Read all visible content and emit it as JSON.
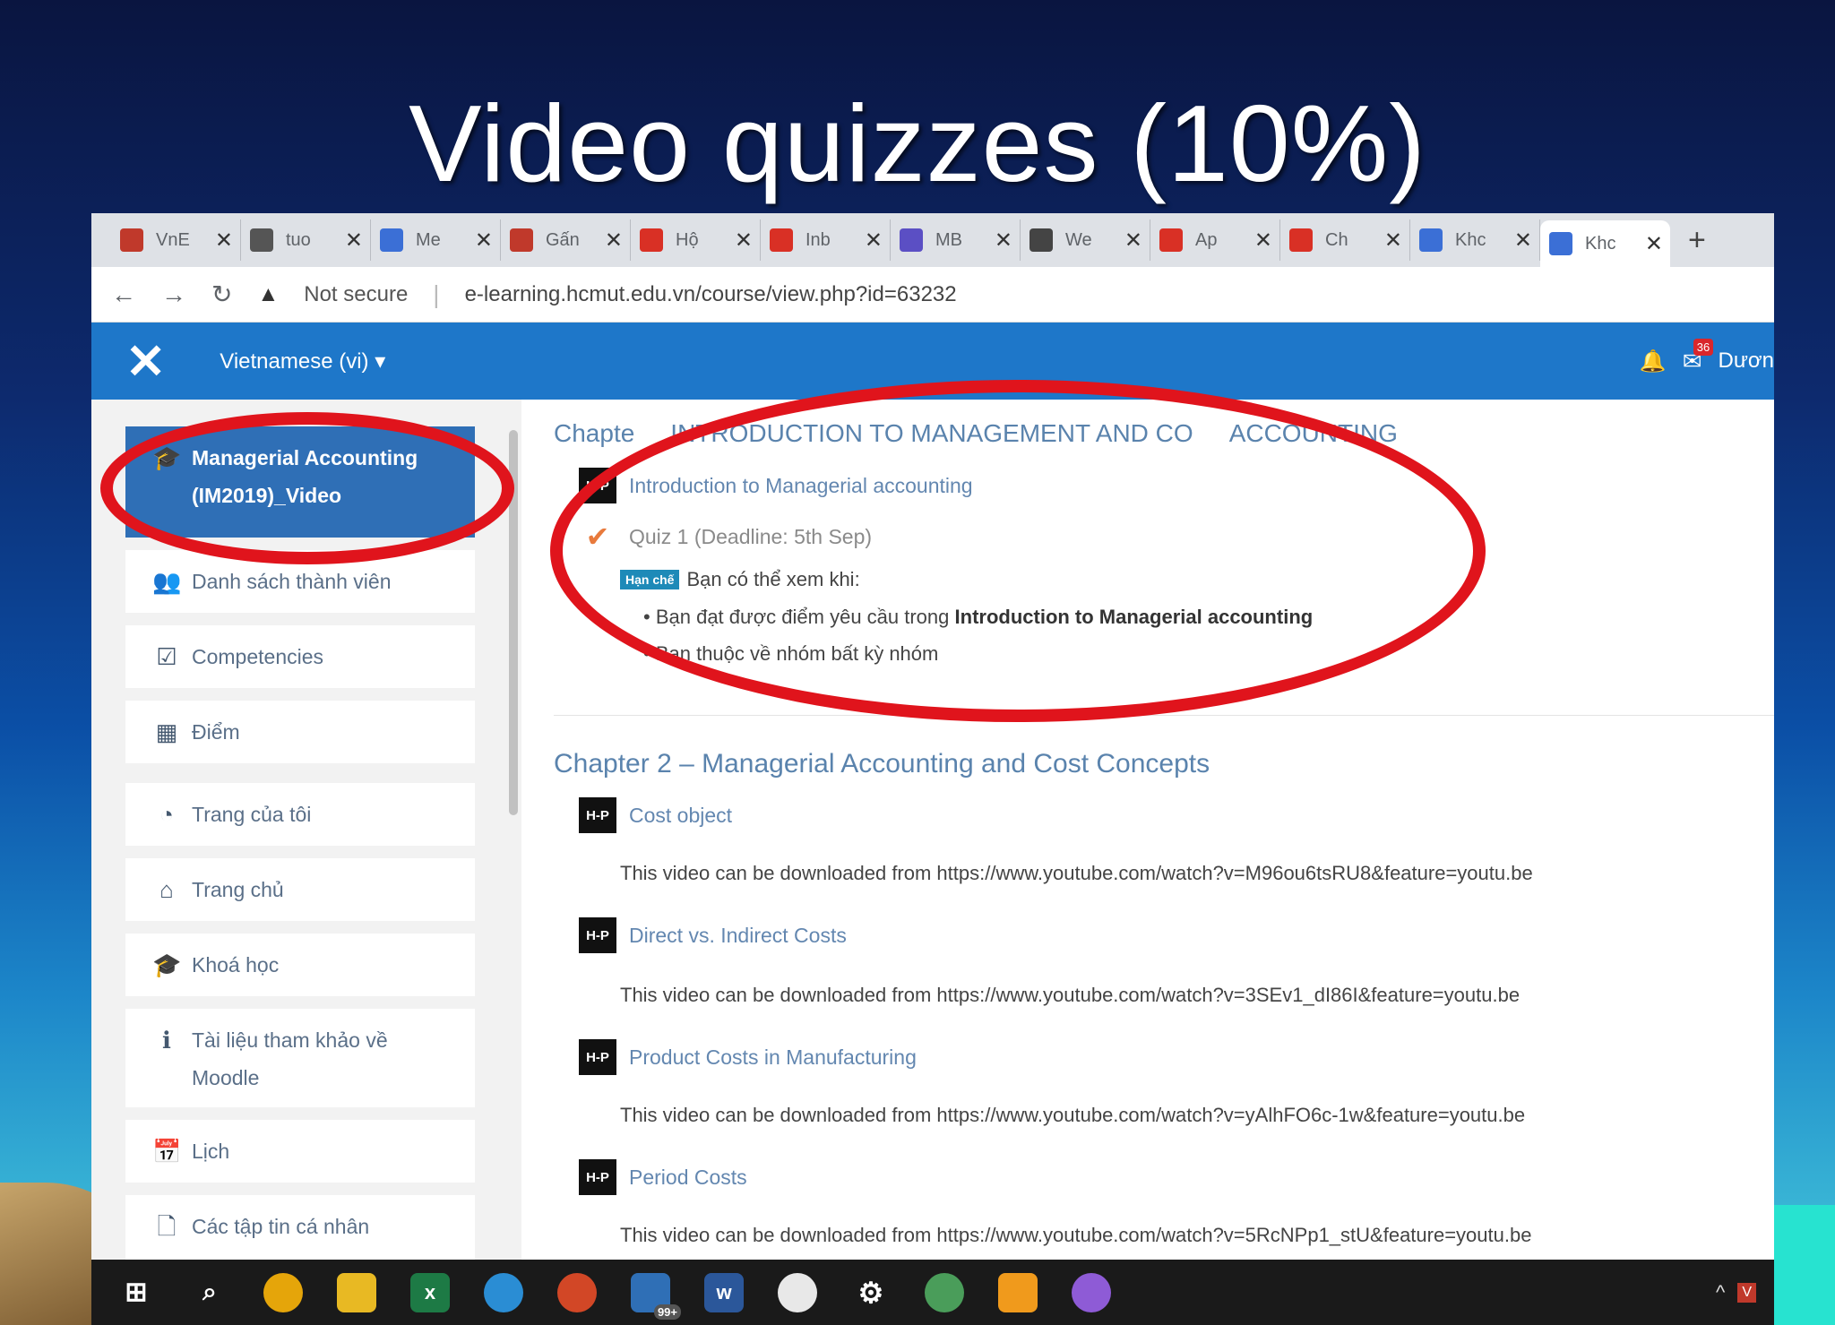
{
  "slide": {
    "title": "Video quizzes (10%)"
  },
  "browser": {
    "tabs": [
      {
        "label": "VnE",
        "favicon_color": "#c0392b"
      },
      {
        "label": "tuo",
        "favicon_color": "#555555"
      },
      {
        "label": "Me",
        "favicon_color": "#3b6fd6"
      },
      {
        "label": "Gấn",
        "favicon_color": "#c0392b"
      },
      {
        "label": "Hộ",
        "favicon_color": "#d93025"
      },
      {
        "label": "Inb",
        "favicon_color": "#d93025"
      },
      {
        "label": "MB",
        "favicon_color": "#5b4fc4"
      },
      {
        "label": "We",
        "favicon_color": "#444444"
      },
      {
        "label": "Ap",
        "favicon_color": "#d93025"
      },
      {
        "label": "Ch",
        "favicon_color": "#d93025"
      },
      {
        "label": "Khc",
        "favicon_color": "#3b6fd6"
      },
      {
        "label": "Khc",
        "favicon_color": "#3b6fd6"
      }
    ],
    "address": {
      "security": "Not secure",
      "url": "e-learning.hcmut.edu.vn/course/view.php?id=63232"
    }
  },
  "header": {
    "language": "Vietnamese (vi)",
    "notification_count": "36",
    "user": "Dươn"
  },
  "sidebar": {
    "items": [
      {
        "label": "Managerial Accounting (IM2019)_Video",
        "icon": "graduation-cap-icon"
      },
      {
        "label": "Danh sách thành viên",
        "icon": "users-icon"
      },
      {
        "label": "Competencies",
        "icon": "checkbox-icon"
      },
      {
        "label": "Điểm",
        "icon": "table-icon"
      },
      {
        "label": "Trang của tôi",
        "icon": "dashboard-icon"
      },
      {
        "label": "Trang chủ",
        "icon": "home-icon"
      },
      {
        "label": "Khoá học",
        "icon": "graduation-cap-icon"
      },
      {
        "label": "Tài liệu tham khảo về Moodle",
        "icon": "info-icon"
      },
      {
        "label": "Lịch",
        "icon": "calendar-icon"
      },
      {
        "label": "Các tập tin cá nhân",
        "icon": "file-icon"
      }
    ]
  },
  "content": {
    "chapter1": {
      "title_start": "Chapte",
      "title_end": "INTRODUCTION TO MANAGEMENT AND CO",
      "title_tail": "ACCOUNTING",
      "activity": "Introduction to Managerial accounting",
      "quiz": "Quiz 1 (Deadline: 5th Sep)",
      "restriction_tag": "Hạn chế",
      "restriction_text": "Bạn có thể xem khi:",
      "cond1_prefix": "Bạn đạt được điểm yêu cầu trong ",
      "cond1_bold": "Introduction to Managerial accounting",
      "cond2": "Bạn thuộc về nhóm bất kỳ nhóm"
    },
    "chapter2": {
      "title": "Chapter 2 – Managerial Accounting and Cost Concepts",
      "activities": [
        {
          "title": "Cost object",
          "download": "This video can be downloaded from https://www.youtube.com/watch?v=M96ou6tsRU8&feature=youtu.be"
        },
        {
          "title": "Direct vs. Indirect Costs",
          "download": "This video can be downloaded from https://www.youtube.com/watch?v=3SEv1_dI86I&feature=youtu.be"
        },
        {
          "title": "Product Costs in Manufacturing",
          "download": "This video can be downloaded from https://www.youtube.com/watch?v=yAlhFO6c-1w&feature=youtu.be"
        },
        {
          "title": "Period Costs",
          "download": "This video can be downloaded from https://www.youtube.com/watch?v=5RcNPp1_stU&feature=youtu.be"
        }
      ]
    },
    "hp_label": "H-P"
  },
  "taskbar": {
    "mail_badge": "99+"
  },
  "colors": {
    "moodle_blue": "#1e77c9",
    "annotation_red": "#e0141c",
    "sidebar_active": "#2f6fb6"
  }
}
